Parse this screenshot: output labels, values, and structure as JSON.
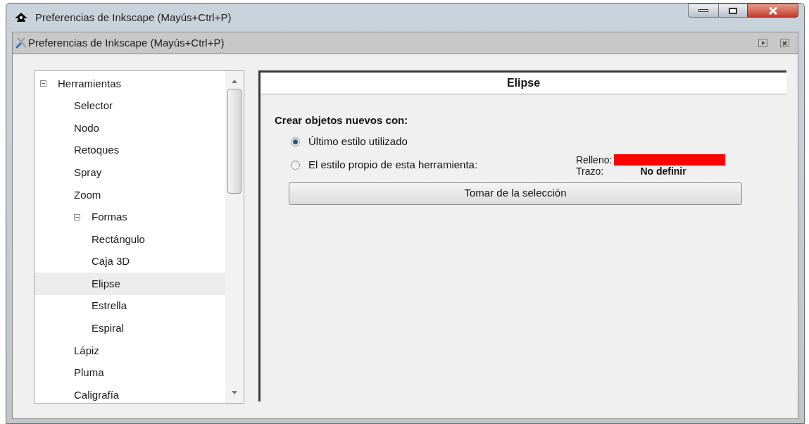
{
  "window": {
    "title": "Preferencias de Inkscape (Mayús+Ctrl+P)"
  },
  "dock": {
    "title": "Preferencias de Inkscape (Mayús+Ctrl+P)"
  },
  "tree": [
    {
      "label": "Herramientas",
      "expanded": true,
      "selected": false,
      "children": [
        {
          "label": "Selector",
          "selected": false
        },
        {
          "label": "Nodo",
          "selected": false
        },
        {
          "label": "Retoques",
          "selected": false
        },
        {
          "label": "Spray",
          "selected": false
        },
        {
          "label": "Zoom",
          "selected": false
        },
        {
          "label": "Formas",
          "expanded": true,
          "selected": false,
          "children": [
            {
              "label": "Rectángulo",
              "selected": false
            },
            {
              "label": "Caja 3D",
              "selected": false
            },
            {
              "label": "Elipse",
              "selected": true
            },
            {
              "label": "Estrella",
              "selected": false
            },
            {
              "label": "Espiral",
              "selected": false
            }
          ]
        },
        {
          "label": "Lápiz",
          "selected": false
        },
        {
          "label": "Pluma",
          "selected": false
        },
        {
          "label": "Caligrafía",
          "selected": false
        }
      ]
    }
  ],
  "panel": {
    "title": "Elipse",
    "section": "Crear objetos nuevos con:",
    "options": [
      {
        "label": "Último estilo utilizado",
        "selected": true
      },
      {
        "label": "El estilo propio de esta herramienta:",
        "selected": false
      }
    ],
    "fill": {
      "label": "Relleno:",
      "color": "#ff0000"
    },
    "stroke": {
      "label": "Trazo:",
      "value": "No definir"
    },
    "button": "Tomar de la selección"
  }
}
